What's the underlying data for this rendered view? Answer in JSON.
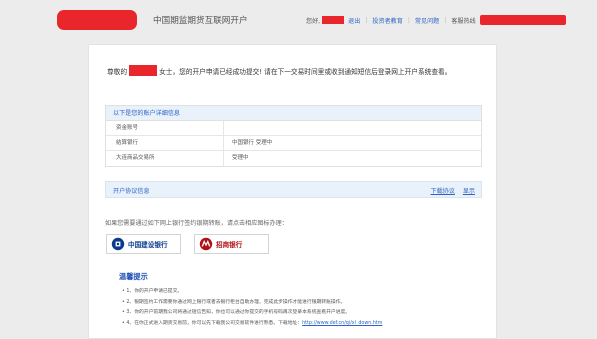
{
  "header": {
    "site_title": "中国期监期货互联网开户",
    "greeting": "您好,",
    "logout": "退出",
    "investor_education": "投资者教育",
    "faq": "常见问题",
    "hotline_label": "客服热线"
  },
  "notice": {
    "prefix": "尊敬的",
    "suffix": "女士，您的开户申请已经成功提交! 请在下一交易时间里或收到通知短信后登录网上开户系统查看。"
  },
  "details": {
    "heading": "以下是您的账户详细信息",
    "rows": [
      {
        "label": "资金账号",
        "value": ""
      },
      {
        "label": "结算银行",
        "value": "中国银行 受理中"
      },
      {
        "label": "大连商品交易所",
        "value": "受理中"
      }
    ]
  },
  "agreement": {
    "label": "开户协议信息",
    "download_link": "下载协议",
    "print_link": "显示"
  },
  "bank_prompt": "如果您需要通过如下网上银行签约银期转账，请点击相应图标办理：",
  "banks": [
    {
      "name": "中国建设银行",
      "subtitle": "China Construction Bank",
      "icon": "ccb-logo-icon"
    },
    {
      "name": "招商银行",
      "icon": "cmb-logo-icon"
    }
  ],
  "tips": {
    "title": "温馨提示",
    "items": [
      "• 1、你的开户申请已提交。",
      "• 2、银期签约工作需要你通过网上银行或者去银行柜台自助办理，完成此步操作才能进行银期转账操作。",
      "• 3、你的开户前期我公司将通过短信告知，你也可以通过你提交的手机号码再次登录本系统查看开户进度。",
      "• 4、在你正式进入期货交易前，你可以先下载我公司交易软件进行熟悉。下载地址："
    ],
    "download_url": "http://www.def.cn/qi/xl_down.htm"
  },
  "colors": {
    "accent": "#2e64c6",
    "redaction": "#e8262b",
    "section_bg": "#e9f1fa"
  }
}
